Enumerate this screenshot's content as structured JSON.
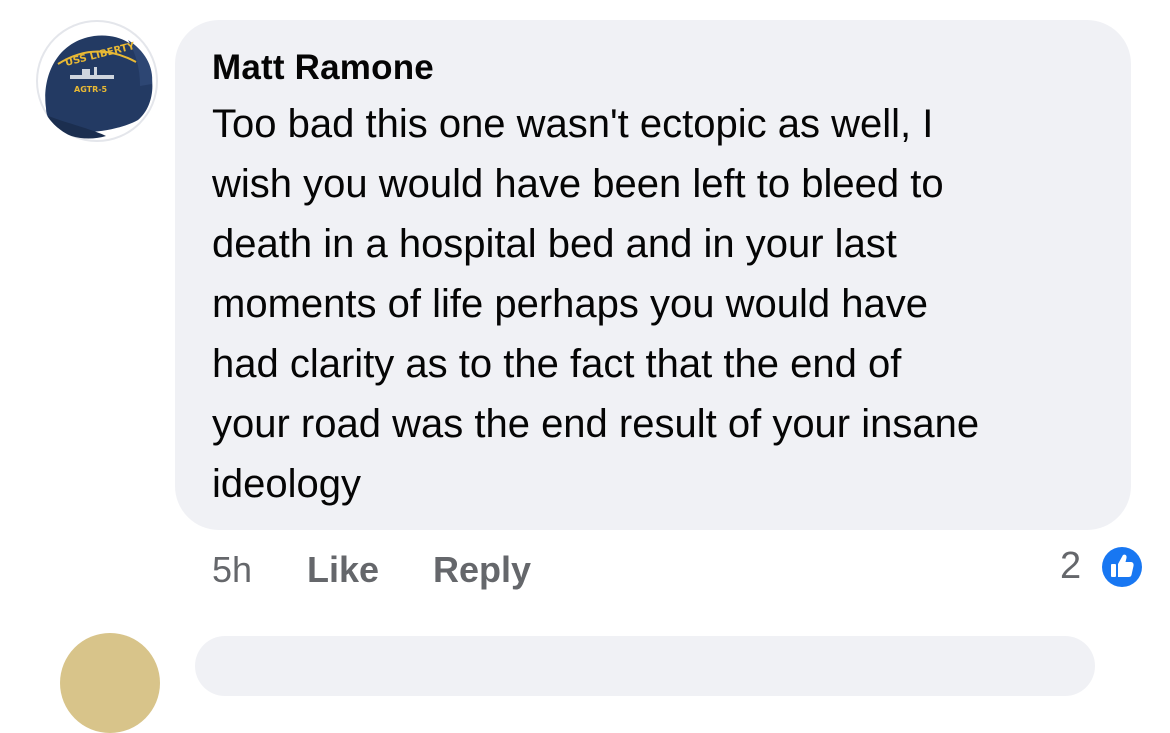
{
  "comment": {
    "author": "Matt Ramone",
    "avatar_text_top": "USS LIBERTY",
    "avatar_text_bottom": "AGTR-5",
    "lines": [
      "Too bad this one wasn't ectopic as well, I",
      "wish you would have been left to bleed to",
      "death in a hospital bed and in your last",
      "moments of life perhaps you would have",
      "had clarity as to the fact that the end of",
      "your road was the end result of your insane",
      "ideology"
    ],
    "timestamp": "5h",
    "like_label": "Like",
    "reply_label": "Reply",
    "reaction_count": "2",
    "reaction_icon": "thumbs-up-icon"
  },
  "colors": {
    "bubble": "#f0f1f5",
    "text": "#050505",
    "meta": "#65676b",
    "like_blue": "#1877f2",
    "cap_navy": "#233a63"
  }
}
